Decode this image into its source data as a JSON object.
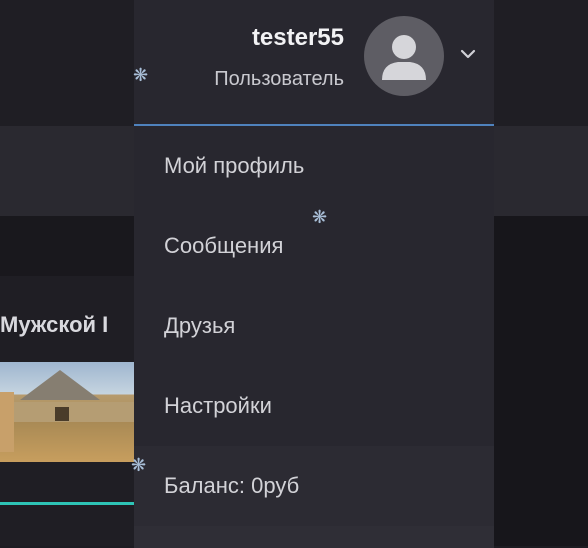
{
  "user": {
    "name": "tester55",
    "role": "Пользователь"
  },
  "menu": {
    "items": [
      {
        "label": "Мой профиль"
      },
      {
        "label": "Сообщения"
      },
      {
        "label": "Друзья"
      },
      {
        "label": "Настройки"
      },
      {
        "label": "Баланс: 0руб"
      }
    ]
  },
  "card": {
    "title": "Мужской I"
  },
  "icons": {
    "avatar": "user-silhouette-icon",
    "dropdown_toggle": "chevron-down-icon",
    "decoration": "snowflake-icon"
  },
  "colors": {
    "menu_bg": "#28272f",
    "accent_underline": "#4f82bd",
    "progress": "#2ec4b6"
  }
}
